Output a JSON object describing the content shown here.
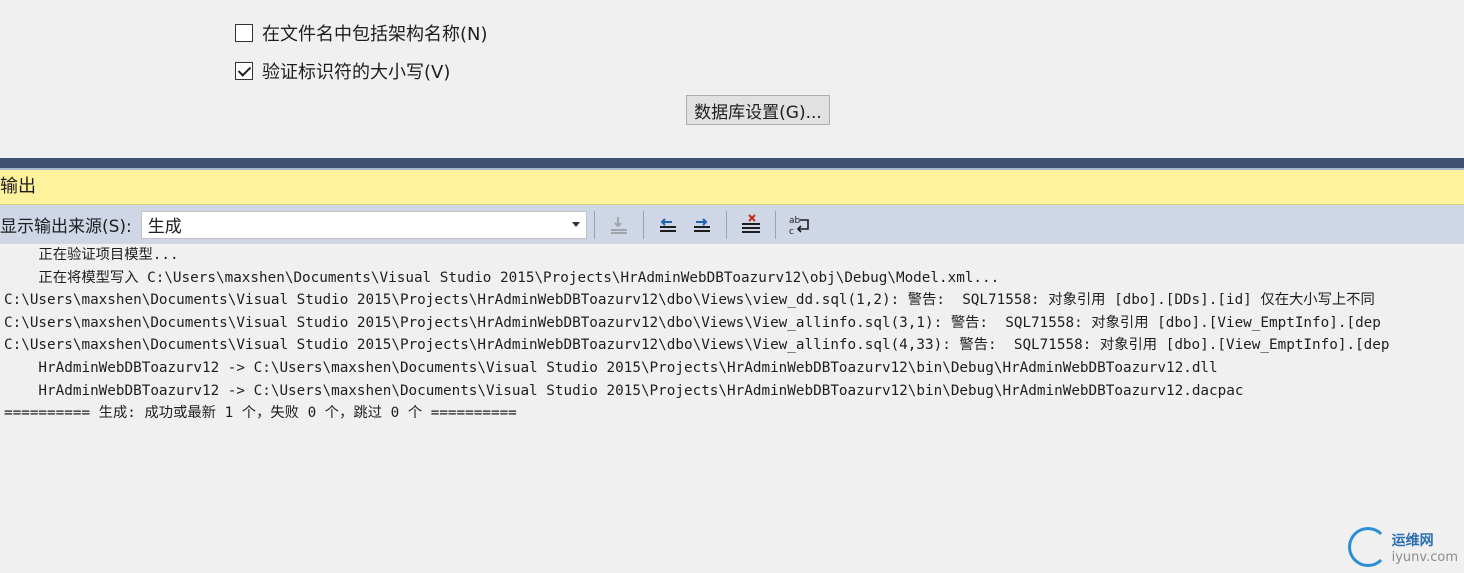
{
  "settings": {
    "checkbox_schema_label": "在文件名中包括架构名称(N)",
    "checkbox_schema_checked": false,
    "checkbox_validate_label": "验证标识符的大小写(V)",
    "checkbox_validate_checked": true,
    "db_settings_button": "数据库设置(G)..."
  },
  "output": {
    "title": "输出",
    "source_label": "显示输出来源(S):",
    "source_value": "生成",
    "lines": [
      "    正在验证项目模型...",
      "    正在将模型写入 C:\\Users\\maxshen\\Documents\\Visual Studio 2015\\Projects\\HrAdminWebDBToazurv12\\obj\\Debug\\Model.xml...",
      "C:\\Users\\maxshen\\Documents\\Visual Studio 2015\\Projects\\HrAdminWebDBToazurv12\\dbo\\Views\\view_dd.sql(1,2): 警告:  SQL71558: 对象引用 [dbo].[DDs].[id] 仅在大小写上不同",
      "C:\\Users\\maxshen\\Documents\\Visual Studio 2015\\Projects\\HrAdminWebDBToazurv12\\dbo\\Views\\View_allinfo.sql(3,1): 警告:  SQL71558: 对象引用 [dbo].[View_EmptInfo].[dep",
      "C:\\Users\\maxshen\\Documents\\Visual Studio 2015\\Projects\\HrAdminWebDBToazurv12\\dbo\\Views\\View_allinfo.sql(4,33): 警告:  SQL71558: 对象引用 [dbo].[View_EmptInfo].[dep",
      "    HrAdminWebDBToazurv12 -> C:\\Users\\maxshen\\Documents\\Visual Studio 2015\\Projects\\HrAdminWebDBToazurv12\\bin\\Debug\\HrAdminWebDBToazurv12.dll",
      "    HrAdminWebDBToazurv12 -> C:\\Users\\maxshen\\Documents\\Visual Studio 2015\\Projects\\HrAdminWebDBToazurv12\\bin\\Debug\\HrAdminWebDBToazurv12.dacpac",
      "========== 生成: 成功或最新 1 个，失败 0 个，跳过 0 个 =========="
    ]
  },
  "watermark": {
    "line1": "运维网",
    "line2": "iyunv.com"
  },
  "colors": {
    "header_bg": "#fff29d",
    "toolbar_bg": "#cfd6e5",
    "divider": "#3f5170"
  }
}
